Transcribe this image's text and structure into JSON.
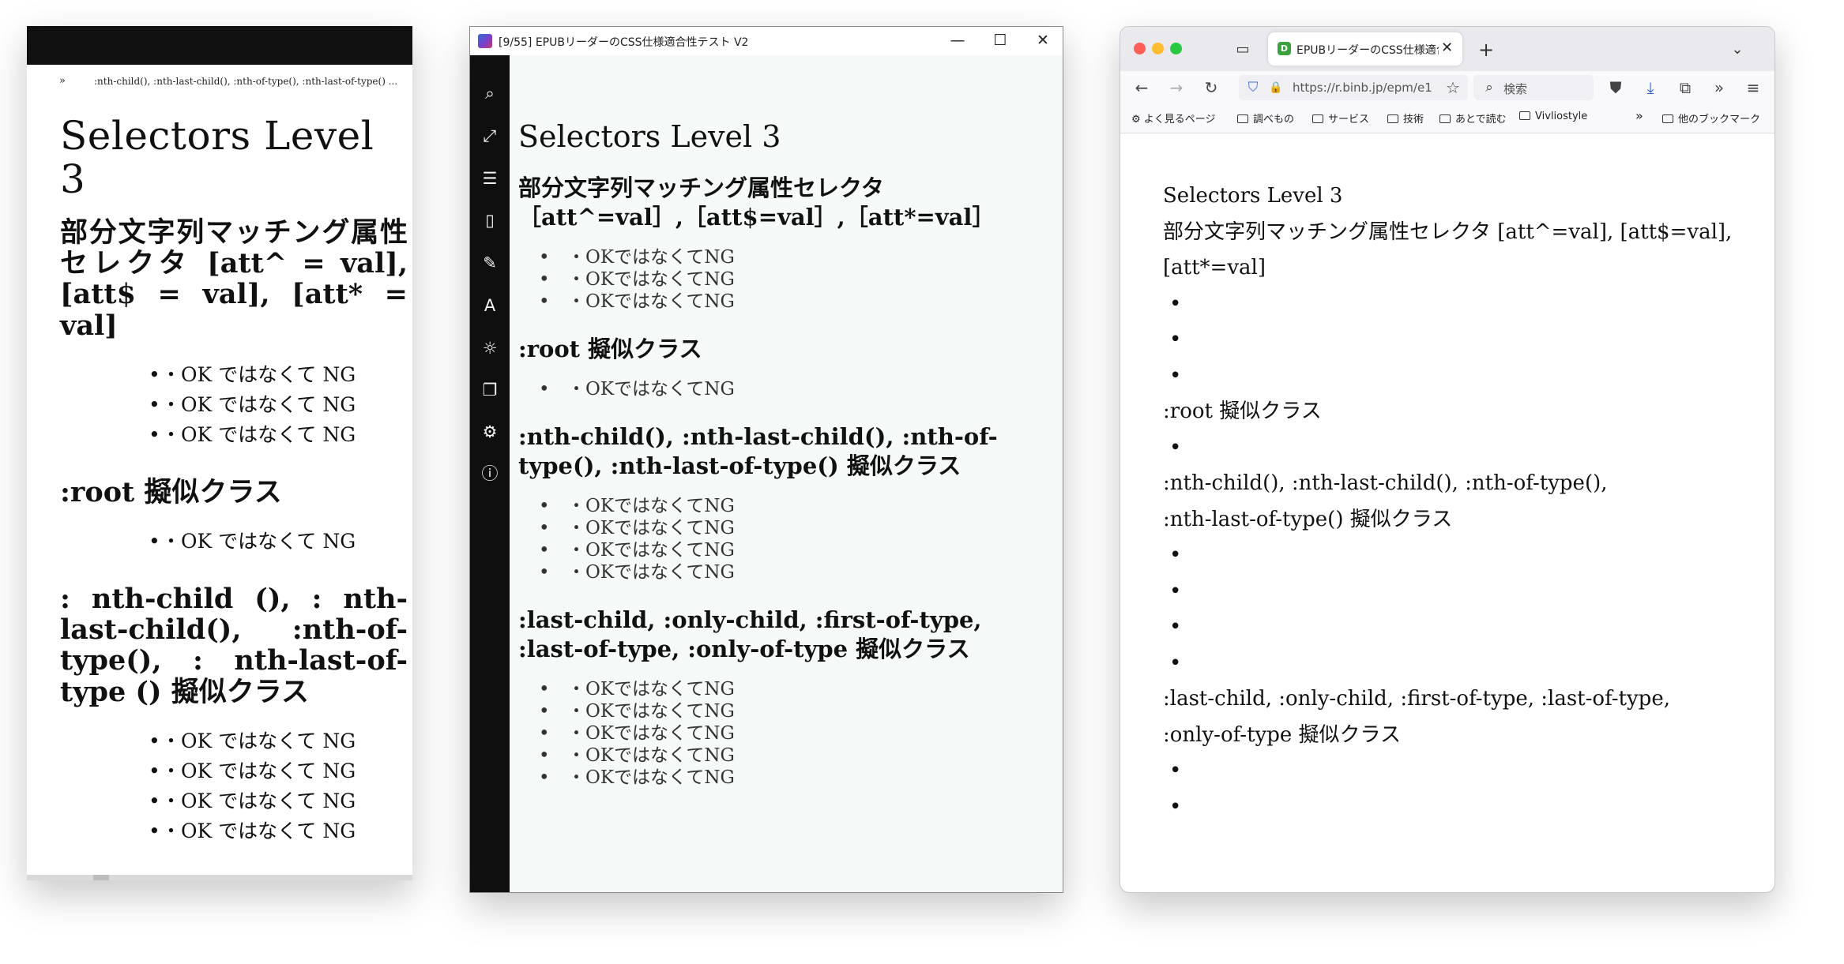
{
  "panel_mobile": {
    "crumb_mark": "»",
    "crumb_text": ":nth-child(), :nth-last-child(), :nth-of-type(), :nth-last-of-type() ...",
    "h1": "Selectors Level 3",
    "sections": [
      {
        "heading": "部分文字列マッチング属性セレクタ [att^ = val], [att$ = val], [att* = val]",
        "items": [
          "・OK ではなくて NG",
          "・OK ではなくて NG",
          "・OK ではなくて NG"
        ]
      },
      {
        "heading": ":root 擬似クラス",
        "items": [
          "・OK ではなくて NG"
        ]
      },
      {
        "heading": ": nth-child (), : nth-last-child(), :nth-of-type(), : nth-last-of-type () 擬似クラス",
        "items": [
          "・OK ではなくて NG",
          "・OK ではなくて NG",
          "・OK ではなくて NG",
          "・OK ではなくて NG"
        ]
      }
    ],
    "bullet": "•"
  },
  "panel_windows": {
    "window_title": "[9/55] EPUBリーダーのCSS仕様適合性テスト V2",
    "controls": {
      "minimize": "—",
      "maximize": "☐",
      "close": "✕"
    },
    "sidebar_icons": [
      "⌕",
      "⤢",
      "☰",
      "▯",
      "✎",
      "A",
      "☼",
      "❐",
      "⚙",
      "ⓘ"
    ],
    "h1": "Selectors Level 3",
    "sections": [
      {
        "heading": "部分文字列マッチング属性セレクタ［att^=val］,［att$=val］,［att*=val］",
        "items": [
          "・OKではなくてNG",
          "・OKではなくてNG",
          "・OKではなくてNG"
        ]
      },
      {
        "heading": ":root 擬似クラス",
        "items": [
          "・OKではなくてNG"
        ]
      },
      {
        "heading": ":nth-child(), :nth-last-child(), :nth-of-type(), :nth-last-of-type() 擬似クラス",
        "items": [
          "・OKではなくてNG",
          "・OKではなくてNG",
          "・OKではなくてNG",
          "・OKではなくてNG"
        ]
      },
      {
        "heading": ":last-child, :only-child, :first-of-type, :last-of-type, :only-of-type 擬似クラス",
        "items": [
          "・OKではなくてNG",
          "・OKではなくてNG",
          "・OKではなくてNG",
          "・OKではなくてNG",
          "・OKではなくてNG"
        ]
      }
    ],
    "bullet": "•"
  },
  "panel_firefox": {
    "tab_title": "EPUBリーダーのCSS仕様適合性",
    "tab_favicon": "D",
    "tab_close": "✕",
    "new_tab": "+",
    "tab_list": "⌄",
    "tab_overview": "▭",
    "nav": {
      "back": "←",
      "forward": "→",
      "reload": "↻",
      "shield": "⛉",
      "lock": "🔒",
      "star": "☆",
      "pocket": "⛊",
      "download": "⤓",
      "extensions": "⧉",
      "more": "»",
      "menu": "≡"
    },
    "url": "https://r.binb.jp/epm/e1",
    "search_icon": "⌕",
    "search_placeholder": "検索",
    "bookmarks": [
      "⚙ よく見るページ",
      "調べもの",
      "サービス",
      "技術",
      "あとで読む",
      "Vivliostyle"
    ],
    "bookmarks_more": "»",
    "bookmarks_other": "他のブックマーク",
    "lines": [
      "Selectors Level 3",
      "部分文字列マッチング属性セレクタ [att^=val], [att$=val],",
      "[att*=val]",
      "•",
      "•",
      "•",
      ":root 擬似クラス",
      "•",
      ":nth-child(), :nth-last-child(), :nth-of-type(),",
      ":nth-last-of-type() 擬似クラス",
      "•",
      "•",
      "•",
      "•",
      ":last-child, :only-child, :first-of-type, :last-of-type,",
      ":only-of-type 擬似クラス",
      "•",
      "•"
    ],
    "colors": {
      "close": "#ff5f57",
      "minimize": "#febc2e",
      "zoom": "#28c840"
    }
  }
}
